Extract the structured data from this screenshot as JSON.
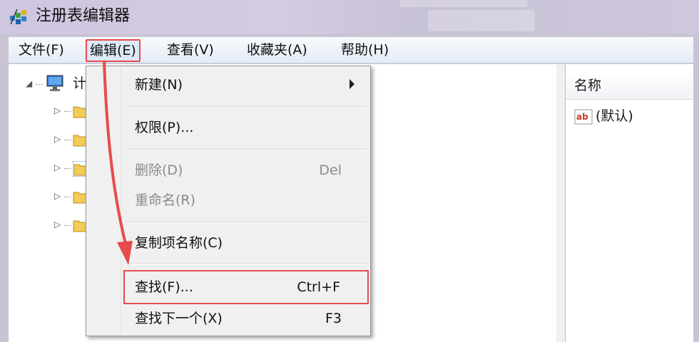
{
  "window": {
    "title": "注册表编辑器",
    "icon": "regedit-icon"
  },
  "menubar": {
    "items": [
      {
        "label": "文件(F)"
      },
      {
        "label": "编辑(E)",
        "active": true
      },
      {
        "label": "查看(V)"
      },
      {
        "label": "收藏夹(A)"
      },
      {
        "label": "帮助(H)"
      }
    ]
  },
  "tree": {
    "root_label": "计",
    "root_icon": "computer-icon",
    "child_icon": "folder-icon",
    "child_count_visible": 5
  },
  "list_pane": {
    "column_header": "名称",
    "rows": [
      {
        "icon": "string-value-icon",
        "name": "(默认)"
      }
    ]
  },
  "edit_menu": {
    "items": [
      {
        "label": "新建(N)",
        "shortcut": "",
        "submenu": true,
        "enabled": true
      },
      {
        "label": "权限(P)...",
        "shortcut": "",
        "enabled": true
      },
      {
        "label": "删除(D)",
        "shortcut": "Del",
        "enabled": false
      },
      {
        "label": "重命名(R)",
        "shortcut": "",
        "enabled": false
      },
      {
        "label": "复制项名称(C)",
        "shortcut": "",
        "enabled": true
      },
      {
        "label": "查找(F)...",
        "shortcut": "Ctrl+F",
        "enabled": true,
        "highlighted": true
      },
      {
        "label": "查找下一个(X)",
        "shortcut": "F3",
        "enabled": true
      }
    ]
  },
  "annotation": {
    "color": "#e64b4b"
  },
  "colors": {
    "menu_bg": "#f0f0f0",
    "menubar_bg": "#e4ebf5",
    "highlight_border": "#e64b4b"
  }
}
